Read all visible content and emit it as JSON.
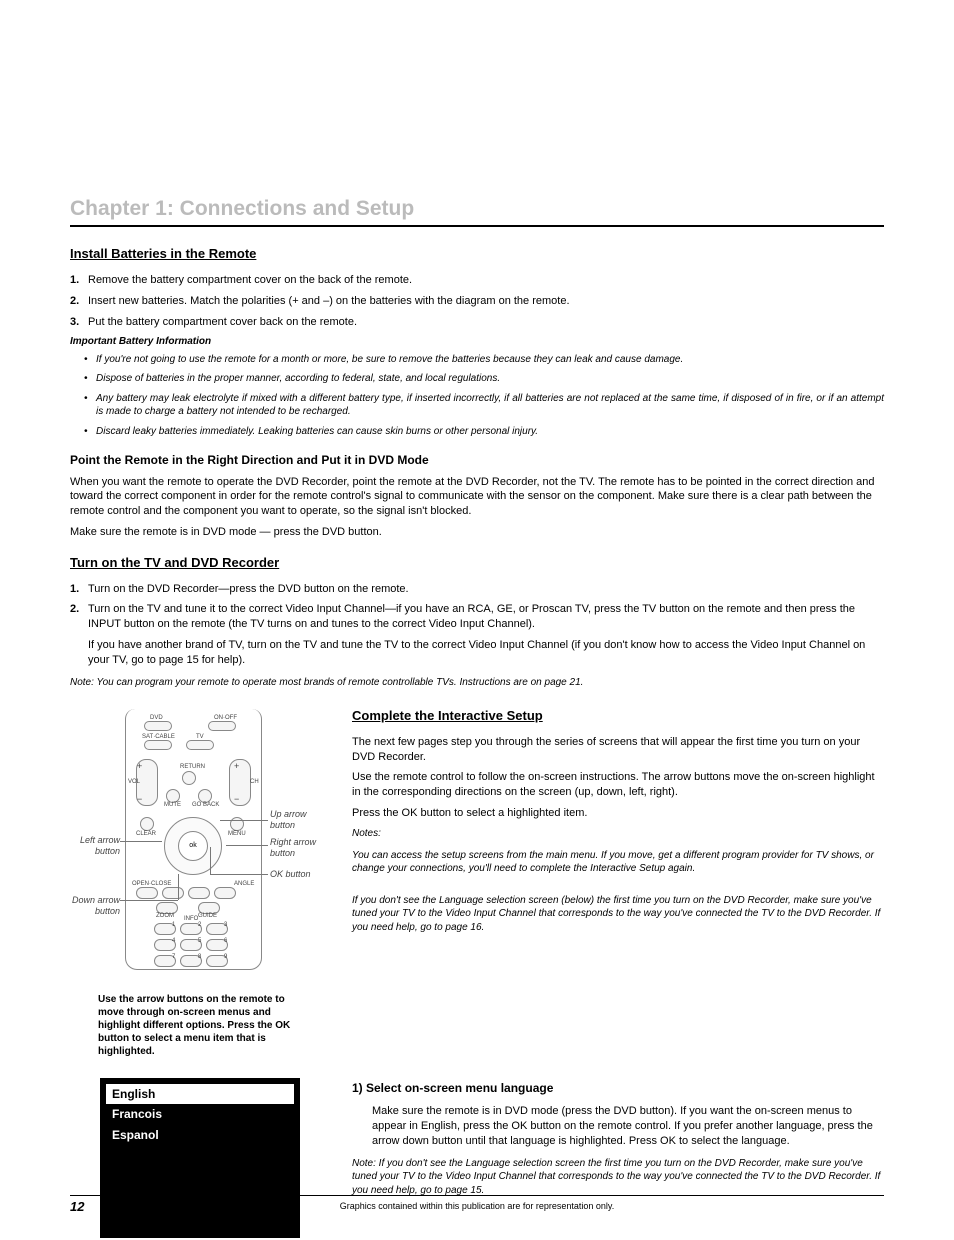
{
  "chapter_title": "Chapter 1: Connections and Setup",
  "sec1": {
    "title": "Install Batteries in the Remote",
    "steps": [
      "Remove the battery compartment cover on the back of the remote.",
      "Insert new batteries. Match the polarities (+ and –) on the batteries with the diagram on the remote.",
      "Put the battery compartment cover back on the remote."
    ],
    "info_title": "Important Battery Information",
    "bullets": [
      "If you're not going to use the remote for a month or more, be sure to remove the batteries because they can leak and cause damage.",
      "Dispose of batteries in the proper manner, according to federal, state, and local regulations.",
      "Any battery may leak electrolyte if mixed with a different battery type, if inserted incorrectly, if all batteries are not replaced at the same time, if disposed of in fire, or if an attempt is made to charge a battery not intended to be recharged.",
      "Discard leaky batteries immediately. Leaking batteries can cause skin burns or other personal injury."
    ]
  },
  "sec2": {
    "title": "Point the Remote in the Right Direction and Put it in DVD Mode",
    "para1": "When you want the remote to operate the DVD Recorder, point the remote at the DVD Recorder, not the TV. The remote has to be pointed in the correct direction and toward the correct component in order for the remote control's signal to communicate with the sensor on the component. Make sure there is a clear path between the remote control and the component you want to operate, so the signal isn't blocked.",
    "para2": "Make sure the remote is in DVD mode — press the DVD button."
  },
  "sec3": {
    "title": "Turn on the TV and DVD Recorder",
    "steps": [
      "Turn on the DVD Recorder—press the DVD button on the remote.",
      "Turn on the TV and tune it to the correct Video Input Channel—if you have an RCA, GE, or Proscan TV, press the TV button on the remote and then press the INPUT button on the remote (the TV turns on and tunes to the correct Video Input Channel)."
    ],
    "step2b": "If you have another brand of TV, turn on the TV and tune the TV to the correct Video Input Channel (if you don't know how to access the Video Input Channel on your TV, go to page 15 for help).",
    "note": "Note: You can program your remote to operate most brands of remote controllable TVs. Instructions are on page 21."
  },
  "remote": {
    "labels": {
      "dvd": "DVD",
      "onoff": "ON·OFF",
      "satcable": "SAT·CABLE",
      "tv": "TV",
      "vol": "VOL",
      "ch": "CH",
      "return": "RETURN",
      "mute": "MUTE",
      "goback": "GO BACK",
      "clear": "CLEAR",
      "menu": "MENU",
      "ok": "ok",
      "openclose": "OPEN·CLOSE",
      "angle": "ANGLE",
      "zoom": "ZOOM",
      "guide": "GUIDE",
      "info": "INFO",
      "n1": "1",
      "n2": "2",
      "n3": "3",
      "n4": "4",
      "n5": "5",
      "n6": "6",
      "n7": "7",
      "n8": "8",
      "n9": "9"
    },
    "callouts": {
      "left": "Left arrow button",
      "up": "Up arrow button",
      "right": "Right arrow button",
      "ok": "OK button",
      "down": "Down arrow button"
    },
    "caption": "Use the arrow buttons on the remote to move through on-screen menus and highlight different options. Press the OK button to select a menu item that is highlighted."
  },
  "lang": {
    "options": [
      "English",
      "Francois",
      "Espanol"
    ]
  },
  "sec4": {
    "title": "Complete the Interactive Setup",
    "p1": "The next few pages step you through the series of screens that will appear the first time you turn on your DVD Recorder.",
    "p2": "Use the remote control to follow the on-screen instructions. The arrow buttons move the on-screen highlight in the corresponding directions on the screen (up, down, left, right).",
    "p3": "Press the OK button to select a highlighted item.",
    "notes_label": "Notes:",
    "note1": "You can access the setup screens from the main menu. If you move, get a different program provider for TV shows, or change your connections, you'll need to complete the Interactive Setup again.",
    "note2": "If you don't see the Language selection screen (below) the first time you turn on the DVD Recorder, make sure you've tuned your TV to the Video Input Channel that corresponds to the way you've connected the TV to the DVD Recorder. If you need help, go to page 16.",
    "step_title": "1) Select on-screen menu language",
    "step_body": "Make sure the remote is in DVD mode (press the DVD button). If you want the on-screen menus to appear in English, press the OK button on the remote control. If you prefer another language, press the arrow down button until that language is highlighted. Press OK to select the language.",
    "step_note": "Note: If you don't see the Language selection screen the first time you turn on the DVD Recorder, make sure you've tuned your TV to the Video Input Channel that corresponds to the way you've connected the TV to the DVD Recorder. If you need help, go to page 15."
  },
  "footer": {
    "page": "12",
    "text": "Graphics contained within this publication are for representation only."
  }
}
